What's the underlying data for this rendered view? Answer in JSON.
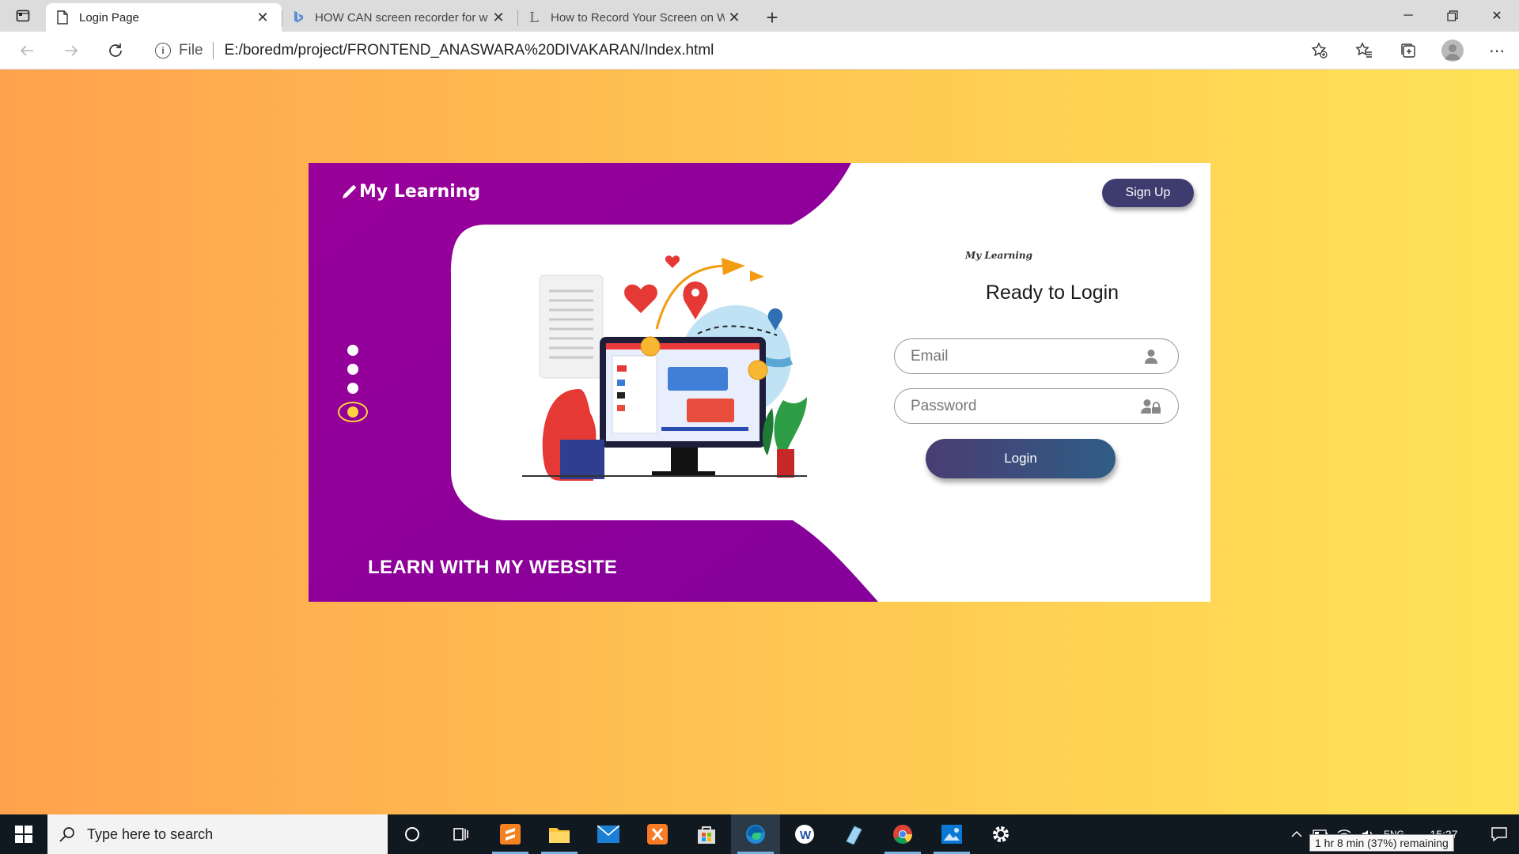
{
  "browser": {
    "tabs": [
      {
        "title": "Login Page",
        "active": true
      },
      {
        "title": "HOW CAN screen recorder for w",
        "active": false
      },
      {
        "title": "How to Record Your Screen on W",
        "active": false
      }
    ],
    "address": {
      "scheme_label": "File",
      "url": "E:/boredm/project/FRONTEND_ANASWARA%20DIVAKARAN/Index.html"
    }
  },
  "page": {
    "brand": "My Learning",
    "tagline": "LEARN WITH MY WEBSITE",
    "signup_label": "Sign Up",
    "mini_logo": "My Learning",
    "login_title": "Ready to Login",
    "email_placeholder": "Email",
    "password_placeholder": "Password",
    "login_label": "Login",
    "slider_dots": 4,
    "active_dot": 4,
    "colors": {
      "purple": "#99009a",
      "button_dark": "#3e3b6e",
      "dot_active": "#ffd23d",
      "bg_start": "#ffa24d",
      "bg_end": "#ffe356"
    }
  },
  "taskbar": {
    "search_placeholder": "Type here to search",
    "time": "15:27",
    "battery_tooltip": "1 hr 8 min (37%) remaining",
    "lang": "ENG"
  }
}
